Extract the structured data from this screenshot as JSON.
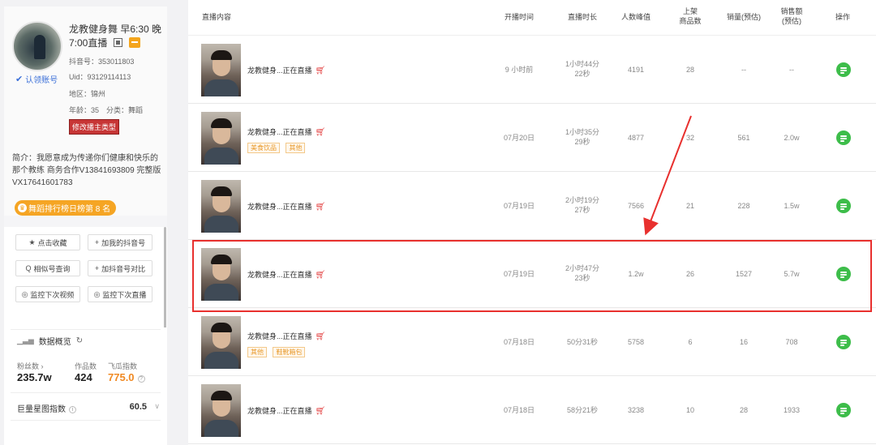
{
  "profile": {
    "name_line1": "龙教健身舞 早6:30 晚",
    "name_line2": "7:00直播",
    "douyin_id": "抖音号：353011803",
    "uid": "Uid：93129114113",
    "region": "地区：锦州",
    "age_category": "年龄：35　分类：舞蹈",
    "modify_type_label": "修改播主类型",
    "verify_label": "认领账号",
    "intro": "简介：我愿意成为传递你们健康和快乐的那个教练 商务合作V13841693809 完整版VX17641601783",
    "rank_label": "舞蹈排行榜日榜第 8 名"
  },
  "actions": [
    {
      "icon": "★",
      "label": "点击收藏"
    },
    {
      "icon": "+",
      "label": "加我的抖音号"
    },
    {
      "icon": "Q",
      "label": "相似号查询"
    },
    {
      "icon": "+",
      "label": "加抖音号对比"
    },
    {
      "icon": "◎",
      "label": "监控下次视频"
    },
    {
      "icon": "◎",
      "label": "监控下次直播"
    }
  ],
  "overview": {
    "title": "数据概览",
    "fans_label": "粉丝数 ›",
    "fans_value": "235.7w",
    "works_label": "作品数",
    "works_value": "424",
    "feigua_label": "飞瓜指数",
    "feigua_value": "775.0",
    "star_label": "巨量星图指数",
    "star_value": "60.5"
  },
  "table": {
    "headers": {
      "content": "直播内容",
      "start": "开播时间",
      "duration": "直播时长",
      "peak": "人数峰值",
      "goods1": "上架",
      "goods2": "商品数",
      "sales": "销量(预估)",
      "revenue1": "销售额",
      "revenue2": "(预估)",
      "op": "操作"
    },
    "rows": [
      {
        "title": "龙教健身...正在直播",
        "start": "9 小时前",
        "dur1": "1小时44分",
        "dur2": "22秒",
        "peak": "4191",
        "goods": "28",
        "sales": "--",
        "revenue": "--",
        "chip1": "",
        "chip2": ""
      },
      {
        "title": "龙教健身...正在直播",
        "start": "07月20日",
        "dur1": "1小时35分",
        "dur2": "29秒",
        "peak": "4877",
        "goods": "32",
        "sales": "561",
        "revenue": "2.0w",
        "chip1": "美食饮品",
        "chip2": "其他"
      },
      {
        "title": "龙教健身...正在直播",
        "start": "07月19日",
        "dur1": "2小时19分",
        "dur2": "27秒",
        "peak": "7566",
        "goods": "21",
        "sales": "228",
        "revenue": "1.5w",
        "chip1": "",
        "chip2": ""
      },
      {
        "title": "龙教健身...正在直播",
        "start": "07月19日",
        "dur1": "2小时47分",
        "dur2": "23秒",
        "peak": "1.2w",
        "goods": "26",
        "sales": "1527",
        "revenue": "5.7w",
        "chip1": "",
        "chip2": ""
      },
      {
        "title": "龙教健身...正在直播",
        "start": "07月18日",
        "dur1": "50分31秒",
        "dur2": "",
        "peak": "5758",
        "goods": "6",
        "sales": "16",
        "revenue": "708",
        "chip1": "其他",
        "chip2": "鞋靴箱包"
      },
      {
        "title": "龙教健身...正在直播",
        "start": "07月18日",
        "dur1": "58分21秒",
        "dur2": "",
        "peak": "3238",
        "goods": "10",
        "sales": "28",
        "revenue": "1933",
        "chip1": "",
        "chip2": ""
      }
    ]
  },
  "colors": {
    "accent_green": "#3dbd4a",
    "highlight_red": "#e8302e",
    "rank_orange": "#f5a524",
    "chip_orange": "#e89a2b"
  }
}
